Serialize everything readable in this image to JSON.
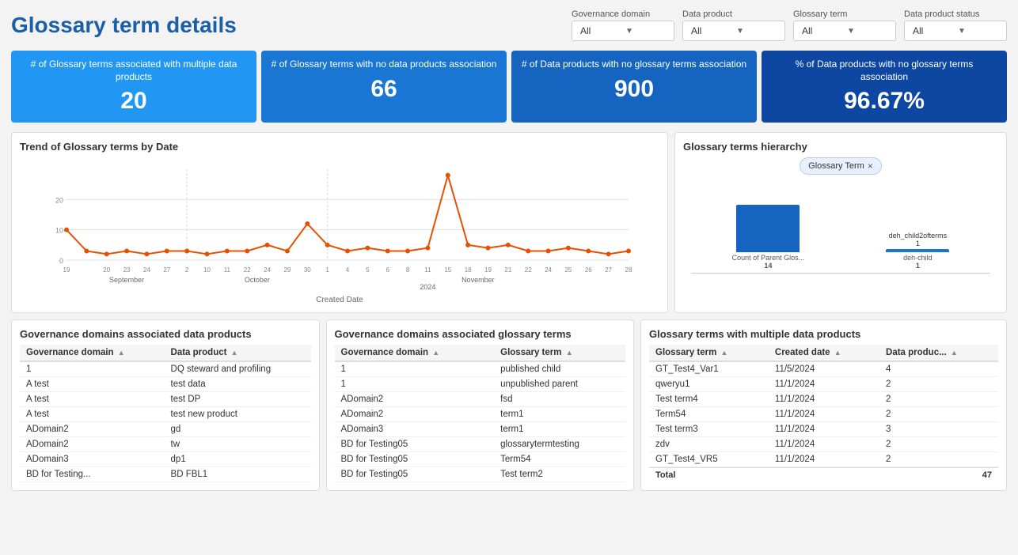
{
  "header": {
    "title": "Glossary term details",
    "filters": [
      {
        "label": "Governance domain",
        "value": "All"
      },
      {
        "label": "Data product",
        "value": "All"
      },
      {
        "label": "Glossary term",
        "value": "All"
      },
      {
        "label": "Data product status",
        "value": "All"
      }
    ]
  },
  "kpi": [
    {
      "label": "# of Glossary terms associated with multiple data products",
      "value": "20",
      "shade": "blue1"
    },
    {
      "label": "# of Glossary terms with no data products association",
      "value": "66",
      "shade": "blue2"
    },
    {
      "label": "# of Data products with no glossary terms association",
      "value": "900",
      "shade": "blue3"
    },
    {
      "label": "% of Data products with no glossary terms association",
      "value": "96.67%",
      "shade": "blue4"
    }
  ],
  "trend_chart": {
    "title": "Trend of Glossary terms by Date",
    "x_label": "Created Date",
    "year_label": "2024",
    "x_axis": [
      "19",
      "",
      "20",
      "23",
      "24",
      "27",
      "2",
      "10",
      "11",
      "22",
      "24",
      "29",
      "30",
      "1",
      "4",
      "5",
      "6",
      "8",
      "11",
      "15",
      "18",
      "19",
      "21",
      "22",
      "24",
      "25",
      "26",
      "27",
      "28"
    ],
    "months": [
      "September",
      "October",
      "November"
    ],
    "y_axis": [
      "0",
      "",
      "",
      "20"
    ],
    "data_points": [
      {
        "x": 0,
        "y": 10
      },
      {
        "x": 1,
        "y": 3
      },
      {
        "x": 2,
        "y": 2
      },
      {
        "x": 3,
        "y": 3
      },
      {
        "x": 4,
        "y": 2
      },
      {
        "x": 5,
        "y": 3
      },
      {
        "x": 6,
        "y": 3
      },
      {
        "x": 7,
        "y": 2
      },
      {
        "x": 8,
        "y": 3
      },
      {
        "x": 9,
        "y": 3
      },
      {
        "x": 10,
        "y": 5
      },
      {
        "x": 11,
        "y": 3
      },
      {
        "x": 12,
        "y": 12
      },
      {
        "x": 13,
        "y": 5
      },
      {
        "x": 14,
        "y": 3
      },
      {
        "x": 15,
        "y": 4
      },
      {
        "x": 16,
        "y": 3
      },
      {
        "x": 17,
        "y": 3
      },
      {
        "x": 18,
        "y": 4
      },
      {
        "x": 19,
        "y": 28
      },
      {
        "x": 20,
        "y": 5
      },
      {
        "x": 21,
        "y": 4
      },
      {
        "x": 22,
        "y": 5
      },
      {
        "x": 23,
        "y": 3
      },
      {
        "x": 24,
        "y": 3
      },
      {
        "x": 25,
        "y": 4
      },
      {
        "x": 26,
        "y": 3
      },
      {
        "x": 27,
        "y": 2
      },
      {
        "x": 28,
        "y": 3
      }
    ]
  },
  "hierarchy": {
    "title": "Glossary terms hierarchy",
    "chip_label": "Glossary Term",
    "bars": [
      {
        "label": "Count of Parent Glos...",
        "sub": "14",
        "value": 14,
        "max": 14
      },
      {
        "label": "deh-child",
        "sub": "1",
        "value": 1,
        "max": 14
      },
      {
        "label": "deh_child2ofterms",
        "sub": "1",
        "value": 1,
        "max": 14
      }
    ]
  },
  "gov_data_products": {
    "title": "Governance domains associated data products",
    "columns": [
      "Governance domain",
      "Data product"
    ],
    "rows": [
      [
        "1",
        "DQ steward and profiling"
      ],
      [
        "A test",
        "test data"
      ],
      [
        "A test",
        "test DP"
      ],
      [
        "A test",
        "test new product"
      ],
      [
        "ADomain2",
        "gd"
      ],
      [
        "ADomain2",
        "tw"
      ],
      [
        "ADomain3",
        "dp1"
      ],
      [
        "BD for Testing...",
        "BD FBL1"
      ]
    ]
  },
  "gov_glossary_terms": {
    "title": "Governance domains associated glossary terms",
    "columns": [
      "Governance domain",
      "Glossary term"
    ],
    "rows": [
      [
        "1",
        "published child"
      ],
      [
        "1",
        "unpublished parent"
      ],
      [
        "ADomain2",
        "fsd"
      ],
      [
        "ADomain2",
        "term1"
      ],
      [
        "ADomain3",
        "term1"
      ],
      [
        "BD for Testing05",
        "glossarytermtesting"
      ],
      [
        "BD for Testing05",
        "Term54"
      ],
      [
        "BD for Testing05",
        "Test term2"
      ]
    ]
  },
  "glossary_multiple": {
    "title": "Glossary terms with multiple data products",
    "columns": [
      "Glossary term",
      "Created date",
      "Data produc..."
    ],
    "rows": [
      [
        "GT_Test4_Var1",
        "11/5/2024",
        "4"
      ],
      [
        "qweryu1",
        "11/1/2024",
        "2"
      ],
      [
        "Test term4",
        "11/1/2024",
        "2"
      ],
      [
        "Term54",
        "11/1/2024",
        "2"
      ],
      [
        "Test term3",
        "11/1/2024",
        "3"
      ],
      [
        "zdv",
        "11/1/2024",
        "2"
      ],
      [
        "GT_Test4_VR5",
        "11/1/2024",
        "2"
      ]
    ],
    "total_label": "Total",
    "total_value": "47"
  }
}
